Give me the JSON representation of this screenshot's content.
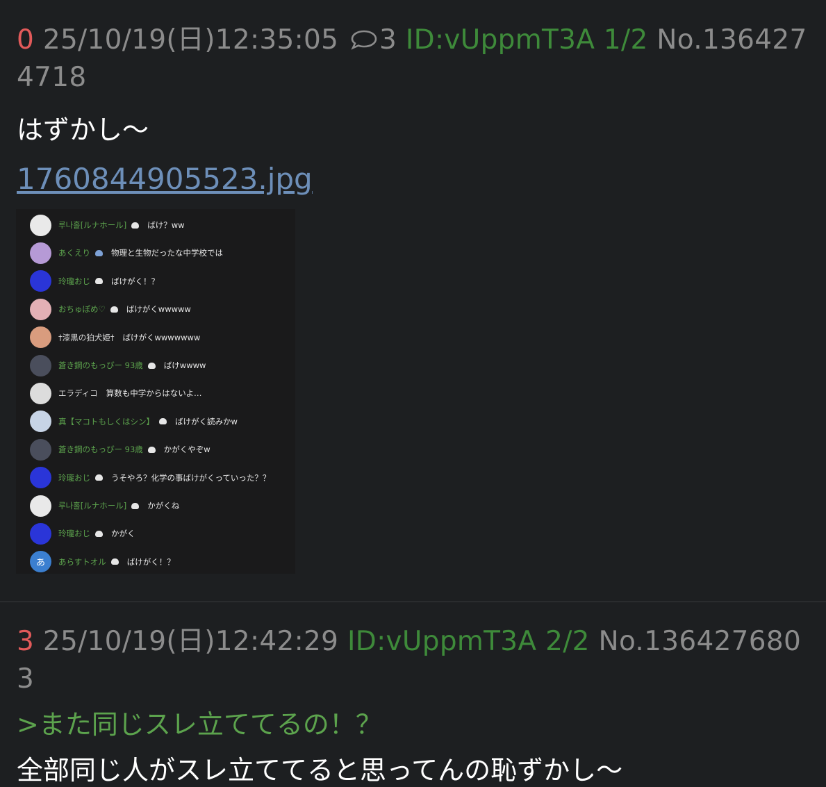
{
  "post1": {
    "number": "0",
    "datetime": "25/10/19(日)12:35:05",
    "reply_count": "3",
    "id": "ID:vUppmT3A 1/2",
    "no": "No.1364274718",
    "body": "はずかし〜",
    "file": "1760844905523.jpg"
  },
  "chat_rows": [
    {
      "avatar_color": "#e9e9e9",
      "avatar_text": "",
      "name": "루나홀[ルナホール]",
      "name_color": "green",
      "badge": "white",
      "message": "ばけ？ww"
    },
    {
      "avatar_color": "#b69ad6",
      "avatar_text": "",
      "name": "あくえり",
      "name_color": "green",
      "badge": "blue",
      "message": "物理と生物だったな中学校では"
    },
    {
      "avatar_color": "#2a35d8",
      "avatar_text": "",
      "name": "玲瓏おじ",
      "name_color": "green",
      "badge": "white",
      "message": "ばけがく！？"
    },
    {
      "avatar_color": "#e3b0b5",
      "avatar_text": "",
      "name": "おちゅぽめ♡",
      "name_color": "green",
      "badge": "white",
      "message": "ばけがくwwwww"
    },
    {
      "avatar_color": "#d99c7e",
      "avatar_text": "",
      "name": "†漆黒の狛犬姫†",
      "name_color": "white",
      "badge": "none",
      "message": "ばけがくwwwwwww"
    },
    {
      "avatar_color": "#4a4e5c",
      "avatar_text": "",
      "name": "蒼き鋼のもっぴー 93歳",
      "name_color": "green",
      "badge": "white",
      "message": "ばけwwww"
    },
    {
      "avatar_color": "#dcdcdc",
      "avatar_text": "",
      "name": "エラディコ",
      "name_color": "white",
      "badge": "none",
      "message": "算数も中学からはないよ…"
    },
    {
      "avatar_color": "#c7d4e6",
      "avatar_text": "",
      "name": "真【マコトもしくはシン】",
      "name_color": "green",
      "badge": "white",
      "message": "ばけがく読みかw"
    },
    {
      "avatar_color": "#4a4e5c",
      "avatar_text": "",
      "name": "蒼き鋼のもっぴー 93歳",
      "name_color": "green",
      "badge": "white",
      "message": "かがくやぞw"
    },
    {
      "avatar_color": "#2a35d8",
      "avatar_text": "",
      "name": "玲瓏おじ",
      "name_color": "green",
      "badge": "white",
      "message": "うそやろ？化学の事ばけがくっていった？？"
    },
    {
      "avatar_color": "#e9e9e9",
      "avatar_text": "",
      "name": "루나홀[ルナホール]",
      "name_color": "green",
      "badge": "white",
      "message": "かがくね"
    },
    {
      "avatar_color": "#2a35d8",
      "avatar_text": "",
      "name": "玲瓏おじ",
      "name_color": "green",
      "badge": "white",
      "message": "かがく"
    },
    {
      "avatar_color": "#3b7fd0",
      "avatar_text": "あ",
      "name": "あらすトオル",
      "name_color": "green",
      "badge": "white",
      "message": "ばけがく！？"
    }
  ],
  "post2": {
    "number": "3",
    "datetime": "25/10/19(日)12:42:29",
    "id": "ID:vUppmT3A 2/2",
    "no": "No.1364276803",
    "quote": ">また同じスレ立ててるの！？",
    "body": "全部同じ人がスレ立ててると思ってんの恥ずかし〜"
  },
  "colors": {
    "background": "#1d1f21",
    "number": "#e25a5a",
    "id": "#3e8a3a",
    "meta": "#8c8c8c",
    "link": "#6d8fb9",
    "quote": "#5ca34d"
  },
  "icons": {
    "reply_count": "speech-bubble-icon"
  }
}
